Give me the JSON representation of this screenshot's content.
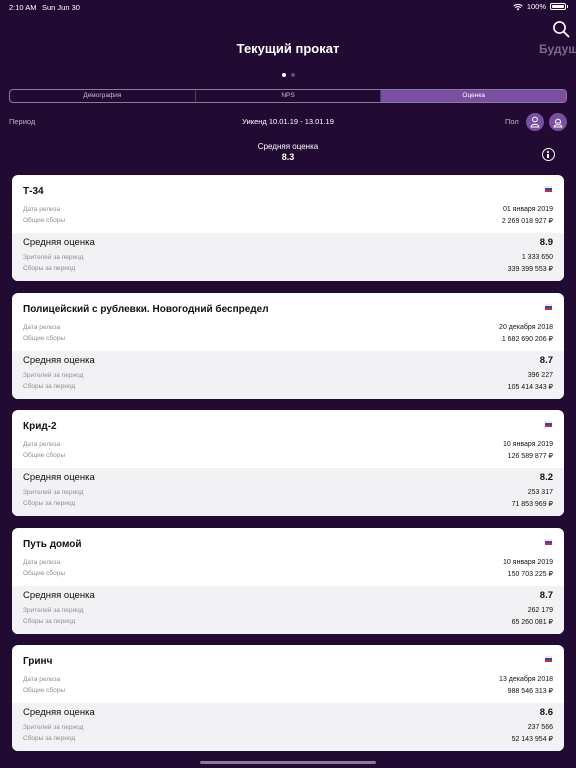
{
  "status_bar": {
    "time": "2:10 AM",
    "date": "Sun Jun 30",
    "battery": "100%"
  },
  "header": {
    "title": "Текущий прокат",
    "next_page_title": "Будущ",
    "page_count": 2,
    "active_page": 0
  },
  "tabs": [
    {
      "label": "Демография",
      "active": false
    },
    {
      "label": "NPS",
      "active": false
    },
    {
      "label": "Оценка",
      "active": true
    }
  ],
  "filters": {
    "period_label": "Период",
    "period_value": "Уикенд 10.01.19 - 13.01.19",
    "gender_label": "Пол"
  },
  "summary": {
    "label": "Средняя оценка",
    "value": "8.3"
  },
  "labels": {
    "release_date": "Дата релиза",
    "total_gross": "Общие сборы",
    "avg_score": "Средняя оценка",
    "viewers": "Зрителей за период",
    "period_gross": "Сборы за период"
  },
  "movies": [
    {
      "title": "Т-34",
      "release_date": "01 января 2019",
      "total_gross": "2 269 018 927 ₽",
      "score": "8.9",
      "viewers": "1 333 650",
      "period_gross": "339 399 553 ₽"
    },
    {
      "title": "Полицейский с рублевки. Новогодний беспредел",
      "release_date": "20 декабря 2018",
      "total_gross": "1 682 690 206 ₽",
      "score": "8.7",
      "viewers": "396 227",
      "period_gross": "105 414 343 ₽"
    },
    {
      "title": "Крид-2",
      "release_date": "10 января 2019",
      "total_gross": "126 589 877 ₽",
      "score": "8.2",
      "viewers": "253 317",
      "period_gross": "71 853 969 ₽"
    },
    {
      "title": "Путь домой",
      "release_date": "10 января 2019",
      "total_gross": "150 703 225 ₽",
      "score": "8.7",
      "viewers": "262 179",
      "period_gross": "65 260 081 ₽"
    },
    {
      "title": "Гринч",
      "release_date": "13 декабря 2018",
      "total_gross": "988 546 313 ₽",
      "score": "8.6",
      "viewers": "237 566",
      "period_gross": "52 143 954 ₽"
    }
  ],
  "colors": {
    "background": "#210b33",
    "accent": "#7a4fa0"
  }
}
